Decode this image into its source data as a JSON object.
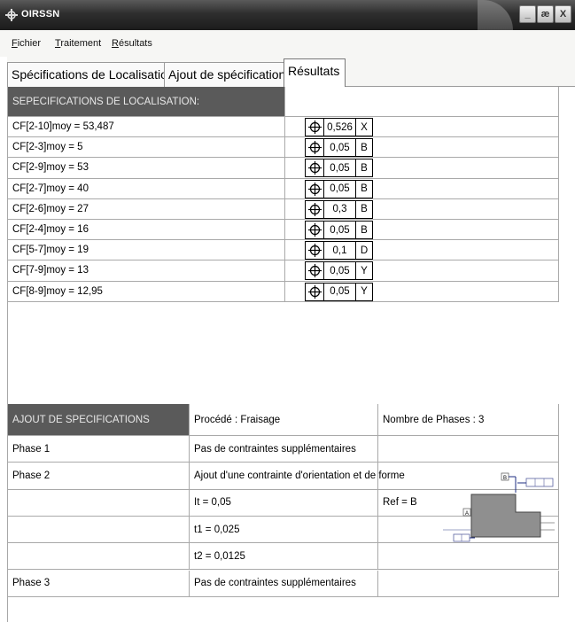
{
  "window": {
    "title": "OIRSSN",
    "buttons": [
      "_",
      "æ",
      "X"
    ]
  },
  "menu": [
    "Fichier",
    "Traitement",
    "Résultats"
  ],
  "tabs": [
    "Spécifications de Localisation",
    "Ajout de spécifications",
    "Résultats"
  ],
  "active_tab": 2,
  "loc_header": "SEPECIFICATIONS DE LOCALISATION:",
  "loc_rows": [
    {
      "label": "CF[2-10]moy = 53,487",
      "tol": "0,526",
      "ref": "X"
    },
    {
      "label": "CF[2-3]moy = 5",
      "tol": "0,05",
      "ref": "B"
    },
    {
      "label": "CF[2-9]moy = 53",
      "tol": "0,05",
      "ref": "B"
    },
    {
      "label": "CF[2-7]moy = 40",
      "tol": "0,05",
      "ref": "B"
    },
    {
      "label": "CF[2-6]moy = 27",
      "tol": "0,3",
      "ref": "B"
    },
    {
      "label": "CF[2-4]moy = 16",
      "tol": "0,05",
      "ref": "B"
    },
    {
      "label": "CF[5-7]moy = 19",
      "tol": "0,1",
      "ref": "D"
    },
    {
      "label": "CF[7-9]moy = 13",
      "tol": "0,05",
      "ref": "Y"
    },
    {
      "label": "CF[8-9]moy = 12,95",
      "tol": "0,05",
      "ref": "Y"
    }
  ],
  "ajout": {
    "header": [
      "AJOUT DE SPECIFICATIONS",
      "Procédé : Fraisage",
      "Nombre de Phases : 3"
    ],
    "rows": [
      [
        "Phase 1",
        "Pas de contraintes supplémentaires",
        ""
      ],
      [
        "Phase 2",
        "Ajout d'une contrainte d'orientation et de forme",
        ""
      ],
      [
        "",
        "It = 0,05",
        "Ref = B"
      ],
      [
        "",
        "t1 = 0,025",
        ""
      ],
      [
        "",
        "t2 = 0,0125",
        ""
      ],
      [
        "Phase 3",
        "Pas de contraintes supplémentaires",
        ""
      ]
    ]
  },
  "figure": {
    "label_b": "B",
    "label_a": "A"
  },
  "icons": {
    "position_symbol": "position-icon"
  }
}
